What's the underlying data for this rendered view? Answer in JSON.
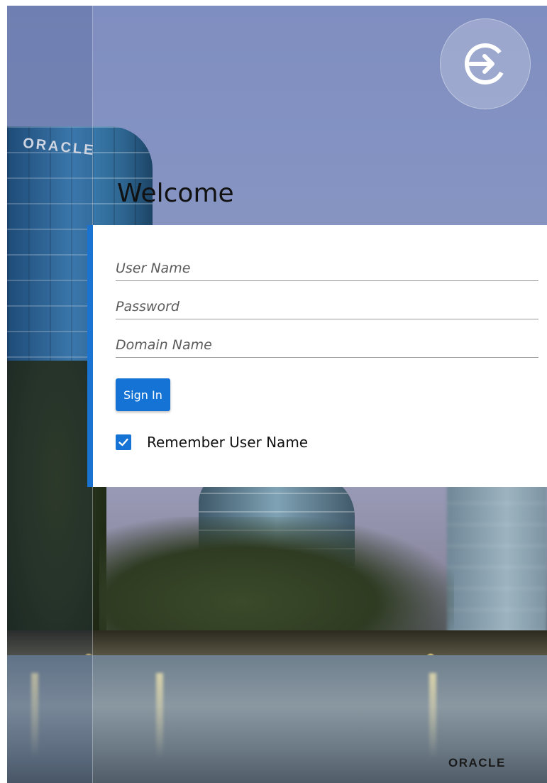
{
  "header": {
    "welcome_title": "Welcome",
    "login_icon": "sign-in-icon"
  },
  "form": {
    "username_placeholder": "User Name",
    "password_placeholder": "Password",
    "domain_placeholder": "Domain Name",
    "signin_label": "Sign In",
    "remember_checked": true,
    "remember_label": "Remember User Name"
  },
  "branding": {
    "building_logo_text": "ORACLE",
    "footer_logo_text": "ORACLE"
  },
  "colors": {
    "accent": "#1473d4",
    "panel_border": "#1b73d1"
  }
}
